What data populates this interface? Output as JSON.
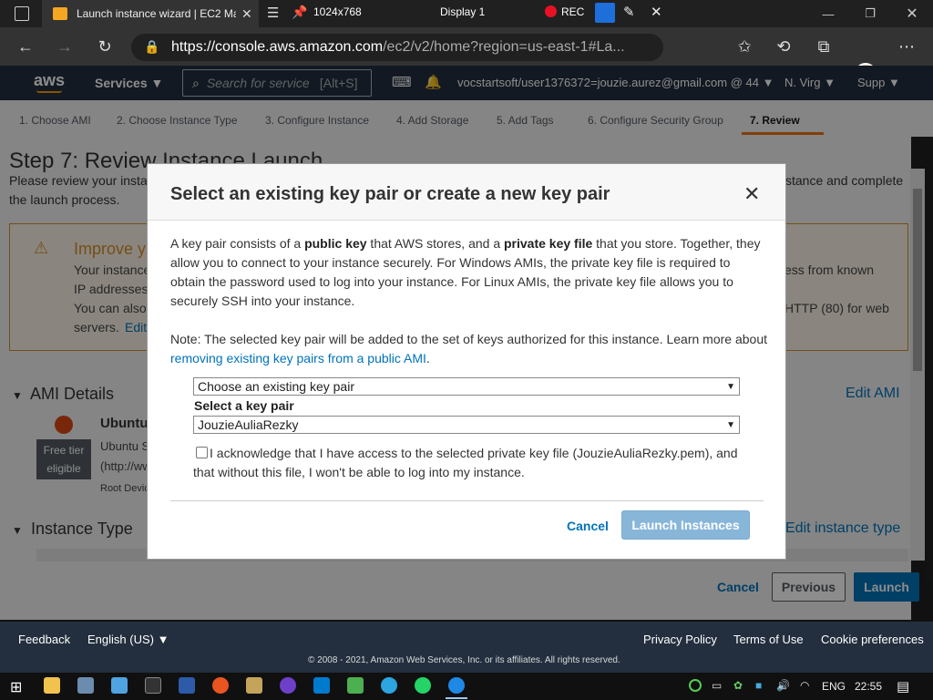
{
  "browser": {
    "tab_title": "Launch instance wizard | EC2 Ma",
    "recording_resolution": "1024x768",
    "display_label": "Display 1",
    "rec_label": "REC",
    "url_host": "https://console.aws.amazon.com",
    "url_path": "/ec2/v2/home?region=us-east-1#La..."
  },
  "aws_header": {
    "logo": "aws",
    "services_label": "Services ▼",
    "search_placeholder": "Search for service",
    "search_shortcut": "[Alt+S]",
    "account": "vocstartsoft/user1376372=jouzie.aurez@gmail.com @ 44 ▼",
    "region": "N. Virg ▼",
    "support": "Supp ▼"
  },
  "wizard_steps": [
    "1. Choose AMI",
    "2. Choose Instance Type",
    "3. Configure Instance",
    "4. Add Storage",
    "5. Add Tags",
    "6. Configure Security Group",
    "7. Review"
  ],
  "page": {
    "heading": "Step 7: Review Instance Launch",
    "intro_left": "Please review your insta",
    "intro_right": "stance and complete",
    "intro_line2": "the launch process.",
    "warning_title": "Improve y",
    "warning_lines": [
      "Your instance",
      "IP addresses",
      "You can also",
      "servers. "
    ],
    "warning_edit": "Edit",
    "warning_right_1": "ess from known",
    "warning_right_2": "HTTP (80) for web",
    "ami_section": "AMI Details",
    "edit_ami": "Edit AMI",
    "ami_name": "Ubuntu",
    "ami_desc_1": "Ubuntu S",
    "ami_desc_2": "(http://ww",
    "root_device": "Root Devic",
    "free_tier": "Free tier eligible",
    "instance_type_section": "Instance Type",
    "edit_instance_type": "Edit instance type",
    "cancel": "Cancel",
    "previous": "Previous",
    "launch": "Launch"
  },
  "modal": {
    "title": "Select an existing key pair or create a new key pair",
    "close": "✕",
    "p1_a": "A key pair consists of a ",
    "p1_b": "public key",
    "p1_c": " that AWS stores, and a ",
    "p1_d": "private key file",
    "p1_e": " that you store. Together, they allow you to connect to your instance securely. For Windows AMIs, the private key file is required to obtain the password used to log into your instance. For Linux AMIs, the private key file allows you to securely SSH into your instance.",
    "note_a": "Note: The selected key pair will be added to the set of keys authorized for this instance. Learn more about ",
    "note_link": "removing existing key pairs from a public AMI",
    "note_end": ".",
    "choice_select": "Choose an existing key pair",
    "key_pair_label": "Select a key pair",
    "key_pair_value": "JouzieAuliaRezky",
    "ack_text": "I acknowledge that I have access to the selected private key file (JouzieAuliaRezky.pem), and that without this file, I won't be able to log into my instance.",
    "ack_checked": false,
    "cancel": "Cancel",
    "launch": "Launch Instances"
  },
  "footer": {
    "feedback": "Feedback",
    "language": "English (US) ▼",
    "privacy": "Privacy Policy",
    "terms": "Terms of Use",
    "cookies": "Cookie preferences",
    "copyright": "© 2008 - 2021, Amazon Web Services, Inc. or its affiliates. All rights reserved."
  },
  "taskbar": {
    "lang": "ENG",
    "time": "22:55"
  },
  "colors": {
    "aws_dark": "#232f3e",
    "aws_orange": "#ec7211",
    "link_blue": "#0073bb",
    "warning_border": "#d68f2a"
  }
}
